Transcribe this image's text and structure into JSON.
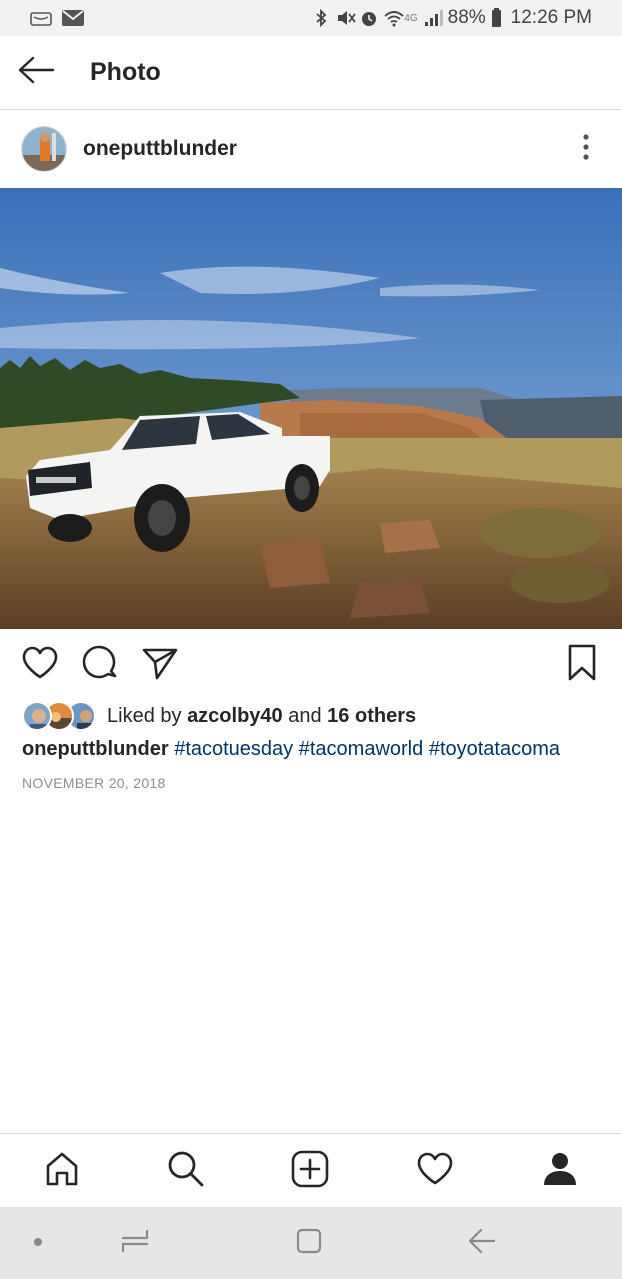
{
  "status_bar": {
    "time": "12:26 PM",
    "battery": "88%",
    "network": "4G",
    "icons": [
      "amazon-icon",
      "mail-icon",
      "bluetooth-icon",
      "mute-icon",
      "alarm-icon",
      "wifi-icon",
      "signal-icon",
      "battery-icon"
    ]
  },
  "header": {
    "title": "Photo",
    "back_icon": "arrow-left-icon"
  },
  "post": {
    "username": "oneputtblunder",
    "more_icon": "more-vertical-icon",
    "photo_description": "white pickup truck on rocky cliff edge",
    "likes": {
      "prefix": "Liked by",
      "user": "azcolby40",
      "conjunction": "and",
      "others": "16 others"
    },
    "caption": {
      "user": "oneputtblunder",
      "tags": [
        "#tacotuesday",
        "#tacomaworld",
        "#toyotatacoma"
      ]
    },
    "date": "NOVEMBER 20, 2018"
  },
  "actions": [
    "heart-icon",
    "comment-icon",
    "share-icon",
    "bookmark-icon"
  ],
  "bottom_nav": [
    "home-icon",
    "search-icon",
    "add-post-icon",
    "activity-heart-icon",
    "profile-icon"
  ],
  "system_nav": [
    "dot-icon",
    "recents-icon",
    "home-square-icon",
    "back-icon"
  ],
  "colors": {
    "hashtag": "#003569",
    "text": "#262626",
    "muted": "#8e8e8e",
    "divider": "#dbdbdb"
  }
}
